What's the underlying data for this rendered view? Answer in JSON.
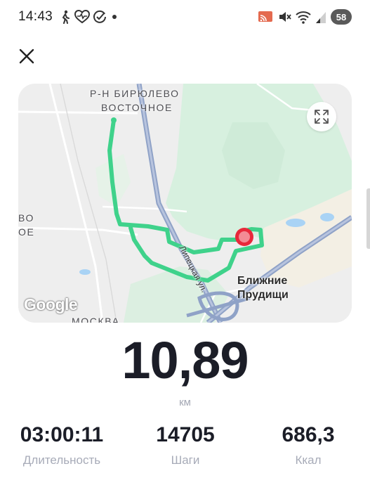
{
  "status_bar": {
    "time": "14:43",
    "left_icons": [
      "walk-icon",
      "heart-pulse-icon",
      "check-circle-icon",
      "dot-icon"
    ],
    "right_icons": [
      "cast-icon",
      "mute-icon",
      "wifi-icon",
      "signal-icon"
    ],
    "battery": "58"
  },
  "map": {
    "district_label_line1": "Р-Н БИРЮЛЕВО",
    "district_label_line2": "ВОСТОЧНОЕ",
    "left_edge_label_1": "ВО",
    "left_edge_label_2": "ОЕ",
    "place_label_line1": "Ближние",
    "place_label_line2": "Прудищи",
    "street_label": "Липецкая ул.",
    "city_label": "МОСКВА",
    "attribution": "Google",
    "route_color": "#3fd28b",
    "end_marker_color": "#e8293b"
  },
  "workout": {
    "distance": "10,89",
    "distance_unit": "км",
    "duration": "03:00:11",
    "duration_label": "Длительность",
    "steps": "14705",
    "steps_label": "Шаги",
    "calories": "686,3",
    "calories_label": "Ккал"
  }
}
